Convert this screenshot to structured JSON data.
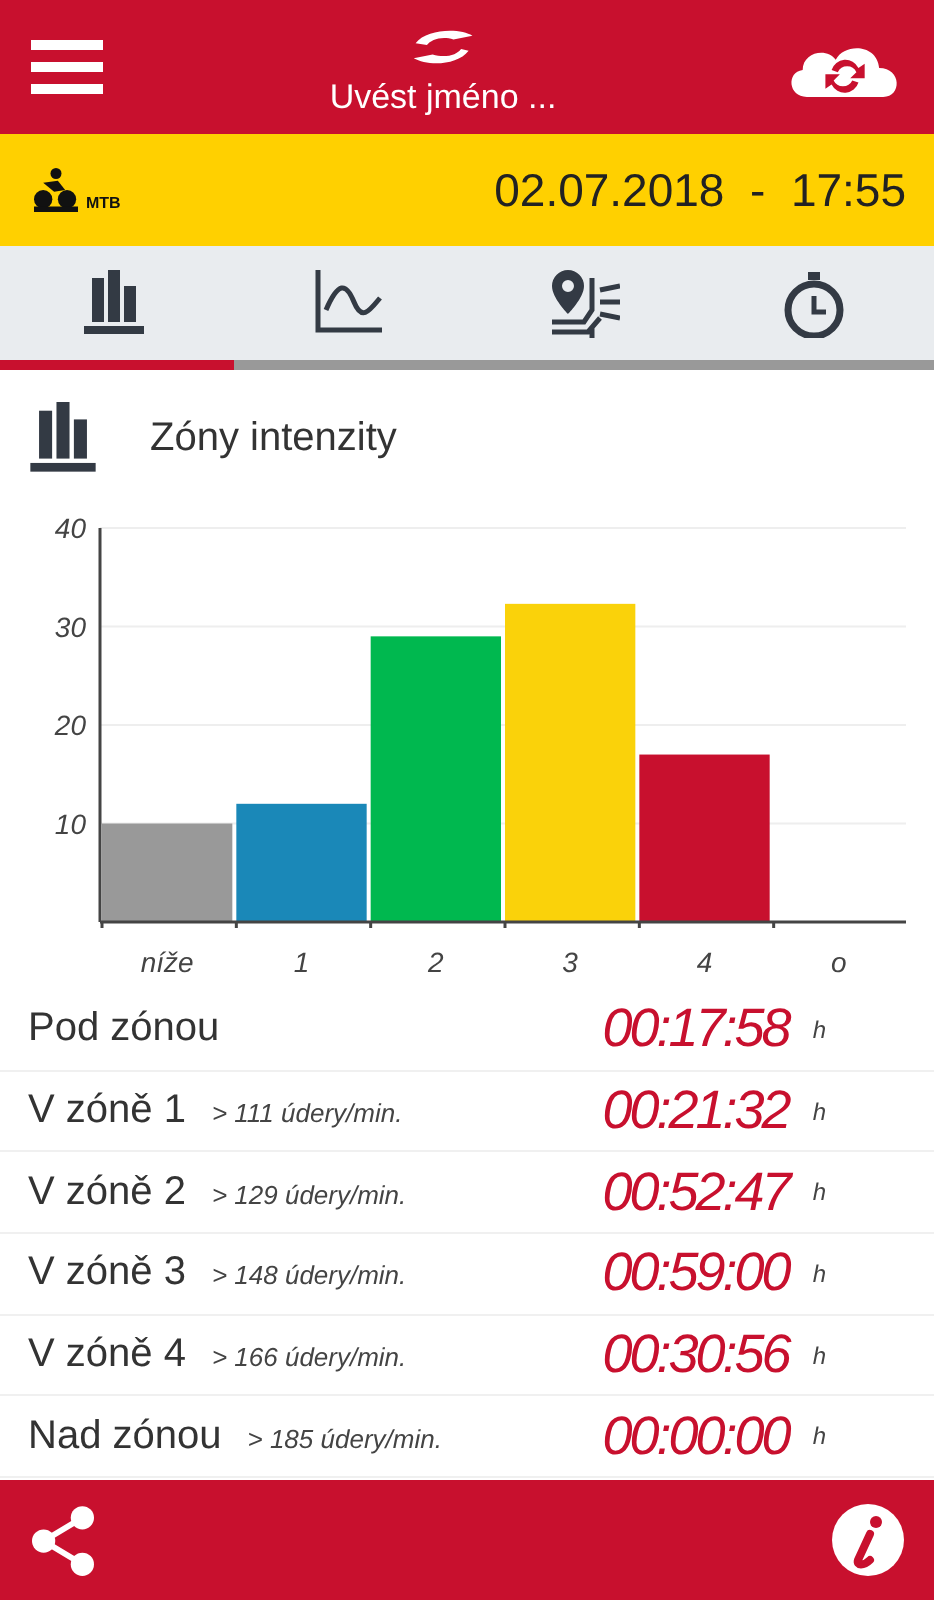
{
  "header": {
    "title": "Uvést jméno ..."
  },
  "activity": {
    "sport": "MTB",
    "datetime": "02.07.2018  -  17:55"
  },
  "tabs": [
    {
      "selected": true
    },
    {
      "selected": false
    },
    {
      "selected": false
    },
    {
      "selected": false
    }
  ],
  "section": {
    "title": "Zóny intenzity"
  },
  "chart_data": {
    "type": "bar",
    "categories": [
      "níže",
      "1",
      "2",
      "3",
      "4",
      "o"
    ],
    "series": [
      {
        "color": "#999999",
        "values": [
          10,
          null,
          null,
          null,
          null,
          null
        ]
      },
      {
        "color": "#1a88b8",
        "values": [
          null,
          12,
          null,
          null,
          null,
          null
        ]
      },
      {
        "color": "#00b84f",
        "values": [
          null,
          null,
          29,
          null,
          null,
          null
        ]
      },
      {
        "color": "#fad20a",
        "values": [
          null,
          null,
          null,
          32.3,
          null,
          null
        ]
      },
      {
        "color": "#c8102e",
        "values": [
          null,
          null,
          null,
          null,
          17,
          null
        ]
      }
    ],
    "grid": true,
    "ylim": [
      0,
      40
    ],
    "yticks": [
      10,
      20,
      30,
      40
    ]
  },
  "zones": [
    {
      "label": "Pod zónou",
      "time": "00:17:58",
      "unit": "h"
    },
    {
      "label": "V zóně 1",
      "threshold": "> 111 údery/min.",
      "time": "00:21:32",
      "unit": "h"
    },
    {
      "label": "V zóně 2",
      "threshold": "> 129 údery/min.",
      "time": "00:52:47",
      "unit": "h"
    },
    {
      "label": "V zóně 3",
      "threshold": "> 148 údery/min.",
      "time": "00:59:00",
      "unit": "h"
    },
    {
      "label": "V zóně 4",
      "threshold": "> 166 údery/min.",
      "time": "00:30:56",
      "unit": "h"
    },
    {
      "label": "Nad zónou",
      "threshold": "> 185 údery/min.",
      "time": "00:00:00",
      "unit": "h"
    }
  ]
}
